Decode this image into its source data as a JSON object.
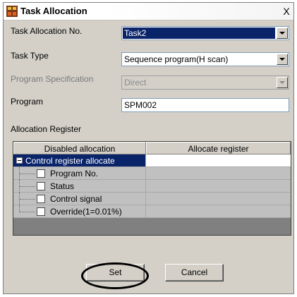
{
  "window": {
    "title": "Task Allocation",
    "close_glyph": "X",
    "icon": "app-grid-icon"
  },
  "form": {
    "task_allocation_no": {
      "label": "Task Allocation No.",
      "value": "Task2"
    },
    "task_type": {
      "label": "Task Type",
      "value": "Sequence program(H scan)"
    },
    "program_specification": {
      "label": "Program Specification",
      "value": "Direct"
    },
    "program": {
      "label": "Program",
      "value": "SPM002"
    }
  },
  "allocation": {
    "section_label": "Allocation Register",
    "columns": [
      "Disabled allocation",
      "Allocate register"
    ],
    "parent": {
      "label": "Control register allocate",
      "expander": "minus-icon"
    },
    "children": [
      {
        "label": "Program No.",
        "checked": false
      },
      {
        "label": "Status",
        "checked": false
      },
      {
        "label": "Control signal",
        "checked": false
      },
      {
        "label": "Override(1=0.01%)",
        "checked": false
      }
    ]
  },
  "buttons": {
    "set": "Set",
    "cancel": "Cancel"
  },
  "colors": {
    "selection": "#0a246a",
    "dialog_bg": "#d4d0c8",
    "grid_bg": "#808080"
  }
}
